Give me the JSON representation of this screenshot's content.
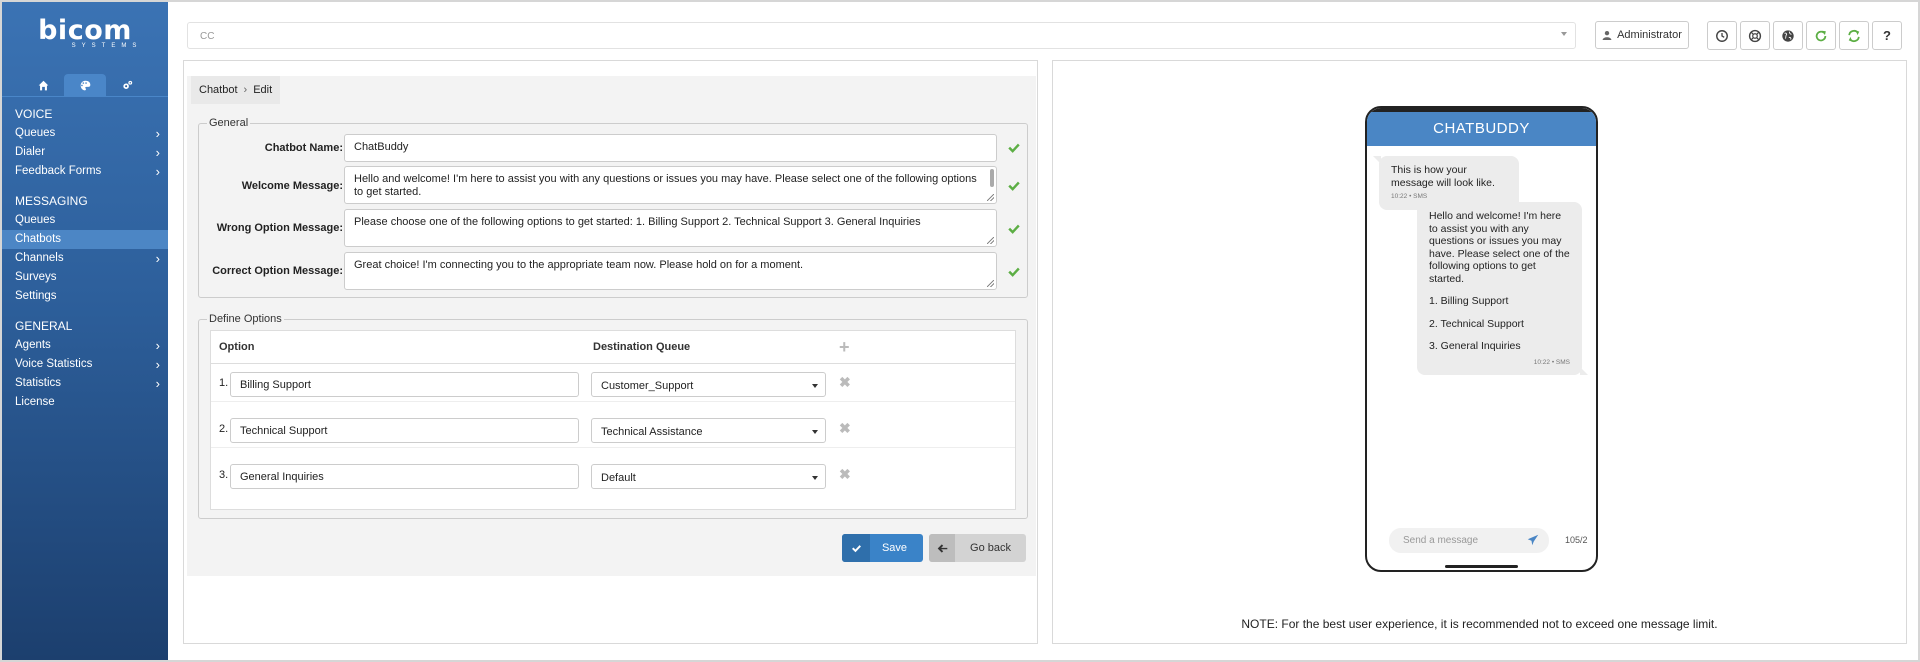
{
  "sidebar": {
    "logo": "bicom",
    "logo_sub": "SYSTEMS",
    "tabs": [
      {
        "icon": "home-icon"
      },
      {
        "icon": "palette-icon"
      },
      {
        "icon": "gears-icon"
      }
    ],
    "sections": [
      {
        "title": "VOICE",
        "items": [
          {
            "label": "Queues",
            "has_submenu": true
          },
          {
            "label": "Dialer",
            "has_submenu": true
          },
          {
            "label": "Feedback Forms",
            "has_submenu": true
          }
        ]
      },
      {
        "title": "MESSAGING",
        "items": [
          {
            "label": "Queues",
            "has_submenu": false
          },
          {
            "label": "Chatbots",
            "has_submenu": false,
            "active": true
          },
          {
            "label": "Channels",
            "has_submenu": true
          },
          {
            "label": "Surveys",
            "has_submenu": false
          },
          {
            "label": "Settings",
            "has_submenu": false
          }
        ]
      },
      {
        "title": "GENERAL",
        "items": [
          {
            "label": "Agents",
            "has_submenu": true
          },
          {
            "label": "Voice Statistics",
            "has_submenu": true
          },
          {
            "label": "Statistics",
            "has_submenu": true
          },
          {
            "label": "License",
            "has_submenu": false
          }
        ]
      }
    ],
    "chevron": "›"
  },
  "topbar": {
    "tenant_select": "CC",
    "user_button": "Administrator",
    "icons": [
      "clock-icon",
      "support-icon",
      "globe-icon",
      "refresh-icon",
      "sync-icon",
      "help-icon"
    ],
    "help_glyph": "?"
  },
  "breadcrumb": {
    "parent": "Chatbot",
    "current": "Edit",
    "separator": "›"
  },
  "general": {
    "legend": "General",
    "fields": [
      {
        "label": "Chatbot Name:",
        "value": "ChatBuddy"
      },
      {
        "label": "Welcome Message:",
        "value": "Hello and welcome! I'm here to assist you with any questions or issues you may have. Please select one of the following options to get started."
      },
      {
        "label": "Wrong Option Message:",
        "value": "Please choose one of the following options to get started: 1. Billing Support 2. Technical Support 3. General Inquiries"
      },
      {
        "label": "Correct Option Message:",
        "value": "Great choice! I'm connecting you to the appropriate team now. Please hold on for a moment."
      }
    ]
  },
  "options": {
    "legend": "Define Options",
    "col_option": "Option",
    "col_queue": "Destination Queue",
    "add_glyph": "+",
    "remove_glyph": "✖",
    "rows": [
      {
        "num": "1.",
        "option": "Billing Support",
        "queue": "Customer_Support"
      },
      {
        "num": "2.",
        "option": "Technical Support",
        "queue": "Technical Assistance"
      },
      {
        "num": "3.",
        "option": "General Inquiries",
        "queue": "Default"
      }
    ]
  },
  "buttons": {
    "save": "Save",
    "back": "Go back"
  },
  "preview": {
    "header": "CHATBUDDY",
    "sample_msg": "This is how your message will look like.",
    "sample_meta": "10:22 • SMS",
    "reply_intro": "Hello and welcome! I'm here to assist you with any questions or issues you may have. Please select one of the following options to get started.",
    "reply_options": [
      "1. Billing Support",
      "2. Technical Support",
      "3. General Inquiries"
    ],
    "reply_meta": "10:22 • SMS",
    "composer_placeholder": "Send a message",
    "counter": "105/2",
    "note": "NOTE: For the best user experience, it is recommended not to exceed one message limit."
  },
  "colors": {
    "accent": "#3a83c8",
    "sidebar": "#2d5f9b",
    "success": "#5cae44",
    "refresh": "#5cae44"
  }
}
